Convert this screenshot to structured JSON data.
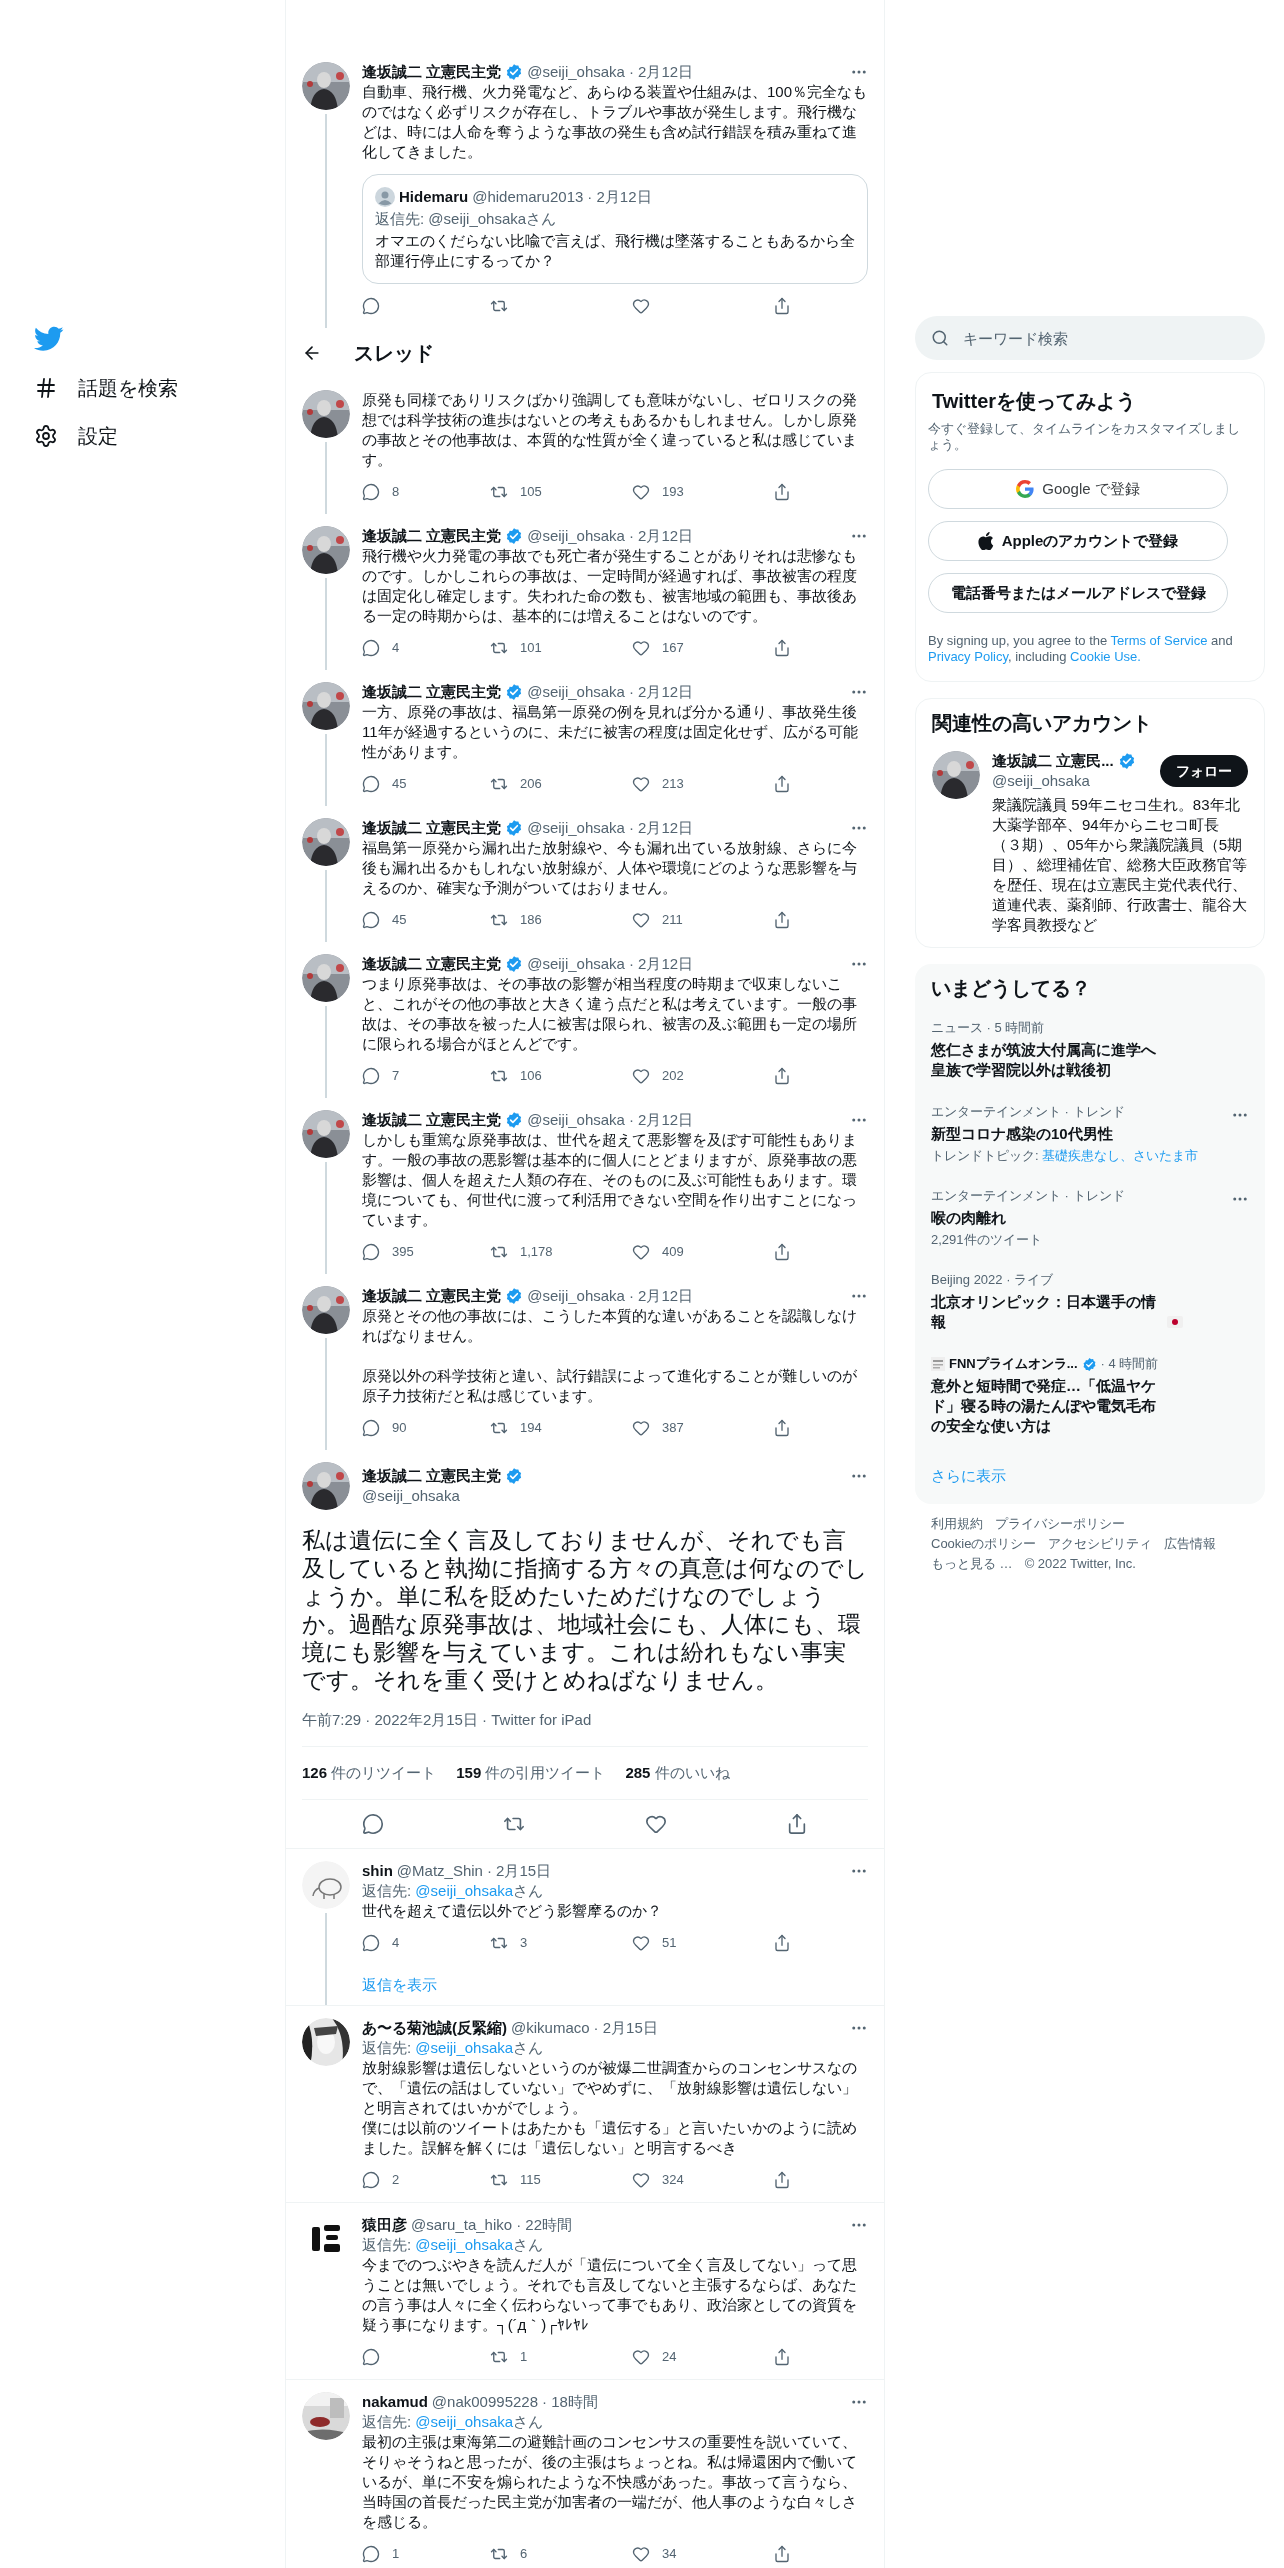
{
  "nav": {
    "items": [
      {
        "label": "話題を検索",
        "kind": "hash"
      },
      {
        "label": "設定",
        "kind": "gear"
      }
    ]
  },
  "header": {
    "title": "スレッド"
  },
  "thread": [
    {
      "name": "逢坂誠二 立憲民主党",
      "verified": true,
      "handle": "@seiji_ohsaka",
      "date": "· 2月12日",
      "text": "自動車、飛行機、火力発電など、あらゆる装置や仕組みは、100％完全なものではなく必ずリスクが存在し、トラブルや事故が発生します。飛行機などは、時には人命を奪うような事故の発生も含め試行錯誤を積み重ねて進化してきました。",
      "quote": {
        "name": "Hidemaru",
        "handle": "@hidemaru2013",
        "date": "· 2月12日",
        "reply_to": {
          "prefix": "返信先: ",
          "mention": "@seiji_ohsaka",
          "suffix": "さん",
          "link": false
        },
        "text": "オマエのくだらない比喩で言えば、飛行機は墜落することもあるから全部運行停止にするってか？"
      }
    },
    {
      "text": "原発も同様でありリスクばかり強調しても意味がないし、ゼロリスクの発想では科学技術の進歩はないとの考えもあるかもしれません。しかし原発の事故とその他事故は、本質的な性質が全く違っていると私は感じています。",
      "stats": {
        "replies": "8",
        "retweets": "105",
        "likes": "193"
      }
    },
    {
      "name": "逢坂誠二 立憲民主党",
      "verified": true,
      "handle": "@seiji_ohsaka",
      "date": "· 2月12日",
      "text": "飛行機や火力発電の事故でも死亡者が発生することがありそれは悲惨なものです。しかしこれらの事故は、一定時間が経過すれば、事故被害の程度は固定化し確定します。失われた命の数も、被害地域の範囲も、事故後ある一定の時期からは、基本的には増えることはないのです。",
      "stats": {
        "replies": "4",
        "retweets": "101",
        "likes": "167"
      }
    },
    {
      "name": "逢坂誠二 立憲民主党",
      "verified": true,
      "handle": "@seiji_ohsaka",
      "date": "· 2月12日",
      "text": "一方、原発の事故は、福島第一原発の例を見れば分かる通り、事故発生後11年が経過するというのに、未だに被害の程度は固定化せず、広がる可能性があります。",
      "stats": {
        "replies": "45",
        "retweets": "206",
        "likes": "213"
      }
    },
    {
      "name": "逢坂誠二 立憲民主党",
      "verified": true,
      "handle": "@seiji_ohsaka",
      "date": "· 2月12日",
      "text": "福島第一原発から漏れ出た放射線や、今も漏れ出ている放射線、さらに今後も漏れ出るかもしれない放射線が、人体や環境にどのような悪影響を与えるのか、確実な予測がついてはおりません。",
      "stats": {
        "replies": "45",
        "retweets": "186",
        "likes": "211"
      }
    },
    {
      "name": "逢坂誠二 立憲民主党",
      "verified": true,
      "handle": "@seiji_ohsaka",
      "date": "· 2月12日",
      "text": "つまり原発事故は、その事故の影響が相当程度の時期まで収束しないこと、これがその他の事故と大きく違う点だと私は考えています。一般の事故は、その事故を被った人に被害は限られ、被害の及ぶ範囲も一定の場所に限られる場合がほとんどです。",
      "stats": {
        "replies": "7",
        "retweets": "106",
        "likes": "202"
      }
    },
    {
      "name": "逢坂誠二 立憲民主党",
      "verified": true,
      "handle": "@seiji_ohsaka",
      "date": "· 2月12日",
      "text": "しかしも重篤な原発事故は、世代を超えて悪影響を及ぼす可能性もあります。一般の事故の悪影響は基本的に個人にとどまりますが、原発事故の悪影響は、個人を超えた人類の存在、そのものに及ぶ可能性もあります。環境についても、何世代に渡って利活用できない空間を作り出すことになっています。",
      "stats": {
        "replies": "395",
        "retweets": "1,178",
        "likes": "409"
      }
    },
    {
      "name": "逢坂誠二 立憲民主党",
      "verified": true,
      "handle": "@seiji_ohsaka",
      "date": "· 2月12日",
      "paragraphs": [
        "原発とその他の事故には、こうした本質的な違いがあることを認識しなければなりません。",
        "原発以外の科学技術と違い、試行錯誤によって進化することが難しいのが原子力技術だと私は感じています。"
      ],
      "spaced": true,
      "stats": {
        "replies": "90",
        "retweets": "194",
        "likes": "387"
      }
    }
  ],
  "main_tweet": {
    "name": "逢坂誠二 立憲民主党",
    "verified": true,
    "handle": "@seiji_ohsaka",
    "text": "私は遺伝に全く言及しておりませんが、それでも言及していると執拗に指摘する方々の真意は何なのでしょうか。単に私を貶めたいためだけなのでしょうか。過酷な原発事故は、地域社会にも、人体にも、環境にも影響を与えています。これは紛れもない事実です。それを重く受けとめねばなりません。",
    "meta": "午前7:29 · 2022年2月15日 · Twitter for iPad",
    "counts": [
      {
        "count": "126",
        "label": "件のリツイート"
      },
      {
        "count": "159",
        "label": "件の引用ツイート"
      },
      {
        "count": "285",
        "label": "件のいいね"
      }
    ]
  },
  "replies": [
    {
      "name": "shin",
      "verified": false,
      "handle": "@Matz_Shin",
      "date": "· 2月15日",
      "reply_to": {
        "prefix": "返信先: ",
        "mention": "@seiji_ohsaka",
        "suffix": "さん",
        "link": true
      },
      "text": "世代を超えて遺伝以外でどう影響摩るのか？",
      "stats": {
        "replies": "4",
        "retweets": "3",
        "likes": "51"
      },
      "show_replies": "返信を表示"
    },
    {
      "name": "あ〜る菊池誠(反緊縮)",
      "verified": false,
      "handle": "@kikumaco",
      "date": "· 2月15日",
      "reply_to": {
        "prefix": "返信先: ",
        "mention": "@seiji_ohsaka",
        "suffix": "さん",
        "link": true
      },
      "paragraphs": [
        "放射線影響は遺伝しないというのが被爆二世調査からのコンセンサスなので、「遺伝の話はしていない」でやめずに、「放射線影響は遺伝しない」と明言されてはいかがでしょう。",
        "僕には以前のツイートはあたかも「遺伝する」と言いたいかのように読めました。誤解を解くには「遺伝しない」と明言するべき"
      ],
      "spaced": false,
      "stats": {
        "replies": "2",
        "retweets": "115",
        "likes": "324"
      }
    },
    {
      "name": "猿田彦",
      "verified": false,
      "handle": "@saru_ta_hiko",
      "date": "· 22時間",
      "reply_to": {
        "prefix": "返信先: ",
        "mention": "@seiji_ohsaka",
        "suffix": "さん",
        "link": true
      },
      "text": "今までのつぶやきを読んだ人が「遺伝について全く言及してない」って思うことは無いでしょう。それでも言及してないと主張するならば、あなたの言う事は人々に全く伝わらないって事でもあり、政治家としての資質を疑う事になります。┐(´д｀)┌ﾔﾚﾔﾚ",
      "stats": {
        "retweets": "1",
        "likes": "24"
      }
    },
    {
      "name": "nakamud",
      "verified": false,
      "handle": "@nak00995228",
      "date": "· 18時間",
      "reply_to": {
        "prefix": "返信先: ",
        "mention": "@seiji_ohsaka",
        "suffix": "さん",
        "link": true
      },
      "text": "最初の主張は東海第二の避難計画のコンセンサスの重要性を説いていて、そりゃそうねと思ったが、後の主張はちょっとね。私は帰還困内で働いているが、単に不安を煽られたような不快感があった。事故って言うなら、当時国の首長だった民主党が加害者の一端だが、他人事のような白々しさを感じる。",
      "stats": {
        "replies": "1",
        "retweets": "6",
        "likes": "34"
      }
    }
  ],
  "sidebar": {
    "search": {
      "placeholder": "キーワード検索"
    },
    "signup": {
      "title": "Twitterを使ってみよう",
      "subtitle": "今すぐ登録して、タイムラインをカスタマイズしましょう。",
      "buttons": [
        {
          "kind": "google",
          "label": "Google で登録"
        },
        {
          "kind": "apple",
          "label": "Appleのアカウントで登録"
        },
        {
          "kind": "plain",
          "label": "電話番号またはメールアドレスで登録"
        }
      ],
      "legal": [
        {
          "text": "By signing up, you agree to the ",
          "link": false
        },
        {
          "text": "Terms of Service",
          "link": true
        },
        {
          "text": " and ",
          "link": false
        },
        {
          "text": "Privacy Policy",
          "link": true
        },
        {
          "text": ", including ",
          "link": false
        },
        {
          "text": "Cookie Use.",
          "link": true
        }
      ]
    },
    "related": {
      "title": "関連性の高いアカウント",
      "account": {
        "name": "逢坂誠二 立憲民...",
        "verified": true,
        "handle": "@seiji_ohsaka",
        "follow": "フォロー",
        "bio": "衆議院議員 59年ニセコ生れ。83年北大薬学部卒、94年からニセコ町長（３期）、05年から衆議院議員（5期目）、総理補佐官、総務大臣政務官等を歴任、現在は立憲民主党代表代行、道連代表、薬剤師、行政書士、龍谷大学客員教授など"
      }
    },
    "trends": {
      "title": "いまどうしてる？",
      "items": [
        {
          "kind": "topic",
          "meta": "ニュース · 5 時間前",
          "title": "悠仁さまが筑波大付属高に進学へ皇族で学習院以外は戦後初",
          "more": false
        },
        {
          "kind": "topic",
          "meta": "エンターテインメント · トレンド",
          "title": "新型コロナ感染の10代男性",
          "sub": "トレンドトピック: ",
          "sub_link": "基礎疾患なし、さいたま市",
          "more": true
        },
        {
          "kind": "topic",
          "meta": "エンターテインメント · トレンド",
          "title": "喉の肉離れ",
          "sub": "2,291件のツイート",
          "more": true
        },
        {
          "kind": "live",
          "meta": "Beijing 2022 · ライブ",
          "title": "北京オリンピック：日本選手の情報",
          "more": false
        },
        {
          "kind": "source",
          "source": "FNNプライムオンラ...",
          "verified": true,
          "meta": "· 4 時間前",
          "title": "意外と短時間で発症…「低温ヤケド」寝る時の湯たんぽや電気毛布の安全な使い方は",
          "more": false
        }
      ],
      "show_more": "さらに表示"
    },
    "footer": {
      "links": [
        "利用規約",
        "プライバシーポリシー",
        "Cookieのポリシー",
        "アクセシビリティ",
        "広告情報",
        "もっと見る …"
      ],
      "copyright": "© 2022 Twitter, Inc."
    }
  }
}
